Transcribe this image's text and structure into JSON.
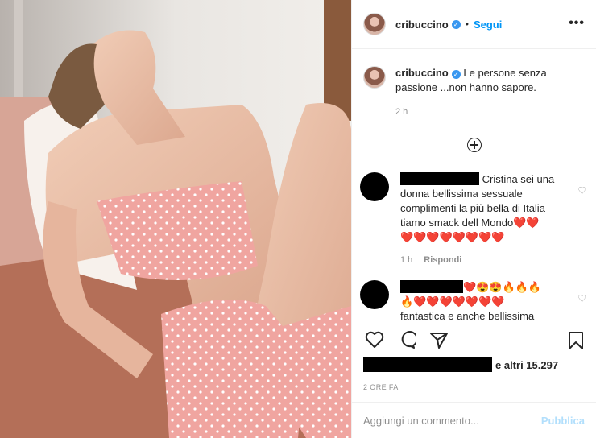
{
  "post": {
    "username": "cribuccino",
    "follow_label": "Segui",
    "more_label": "•••",
    "verified_glyph": "✓"
  },
  "caption": {
    "username": "cribuccino",
    "text": "Le persone senza passione ...non hanno sapore.",
    "time": "2 h"
  },
  "comments": [
    {
      "text": "Cristina sei una donna bellissima sessuale complimenti la più bella di Italia tiamo smack dell Mondo",
      "emoji_line": "❤️❤️",
      "hearts": "❤️❤️❤️❤️❤️❤️❤️❤️",
      "time": "1 h",
      "reply_label": "Rispondi"
    },
    {
      "emoji_line": "❤️😍😍🔥🔥🔥",
      "emoji_line2": "🔥❤️❤️❤️❤️❤️❤️❤️",
      "text": "fantastica e anche bellissima"
    }
  ],
  "likes": {
    "text": "e altri 15.297"
  },
  "timestamp": "2 ORE FA",
  "add_comment": {
    "placeholder": "Aggiungi un commento...",
    "publish_label": "Pubblica"
  },
  "icons": [
    "heart-icon",
    "comment-icon",
    "share-icon",
    "bookmark-icon",
    "add-icon",
    "more-icon"
  ],
  "colors": {
    "accent": "#0095f6",
    "publish_disabled": "#b2dffc",
    "dress": "#f0a5a0"
  }
}
